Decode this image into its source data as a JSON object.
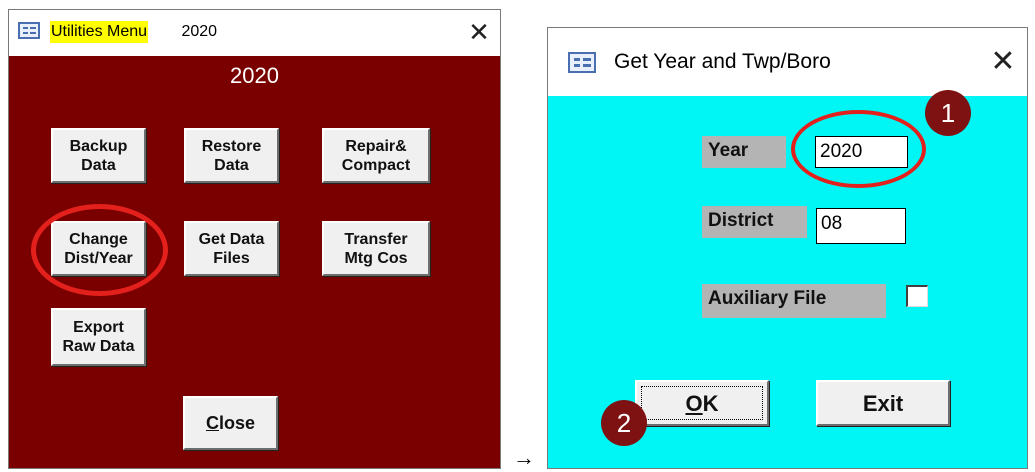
{
  "utilities_window": {
    "title_highlighted": "Utilities Menu",
    "title_rest": " 2020",
    "heading": "2020",
    "buttons": {
      "backup": "Backup\nData",
      "restore": "Restore\nData",
      "repair": "Repair&\nCompact",
      "change": "Change\nDist/Year",
      "get_data": "Get Data\nFiles",
      "transfer": "Transfer\nMtg Cos",
      "export": "Export\nRaw Data",
      "close_key": "C",
      "close_rest": "lose"
    },
    "colors": {
      "background": "#7a0000",
      "title_highlight": "#ffff00"
    }
  },
  "arrow": "→",
  "dialog": {
    "title": "Get Year and Twp/Boro",
    "year_label": "Year",
    "year_value": "2020",
    "district_label": "District",
    "district_value": "08",
    "aux_label": "Auxiliary File",
    "aux_checked": false,
    "ok_key": "O",
    "ok_rest": "K",
    "exit_label": "Exit",
    "colors": {
      "background": "#00f5f5",
      "label_bg": "#b4b4b4"
    }
  },
  "annotations": {
    "step1": "1",
    "step2": "2",
    "colors": {
      "ring": "#e3201b",
      "badge": "#7e1212"
    }
  },
  "icons": [
    "form-icon",
    "close-icon"
  ]
}
